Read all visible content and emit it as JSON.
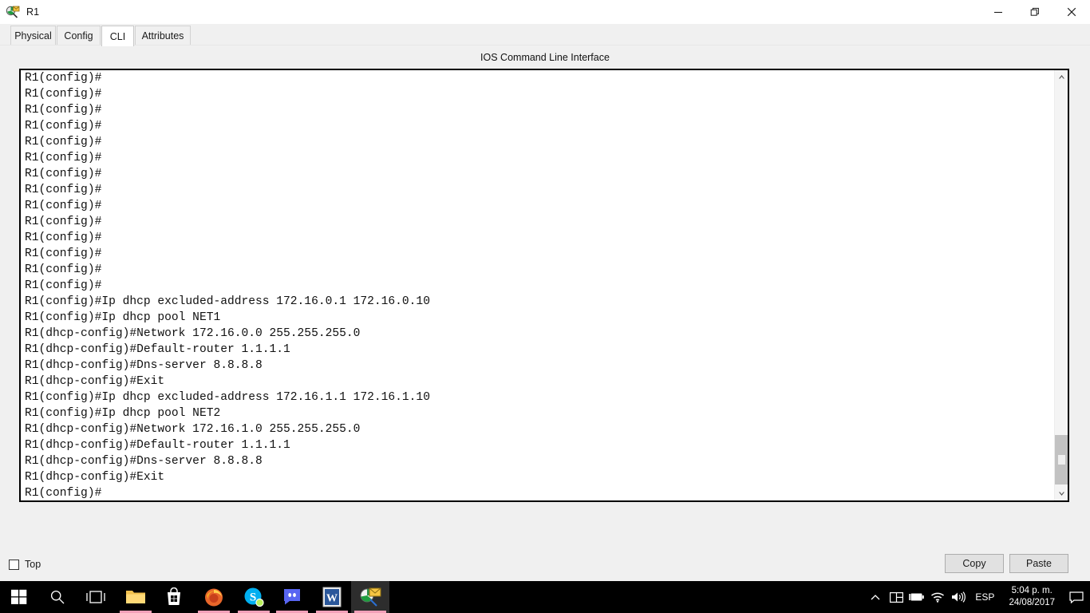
{
  "window": {
    "title": "R1",
    "icon": "packet-tracer-icon",
    "controls": {
      "minimize": "minimize-icon",
      "maximize": "restore-icon",
      "close": "close-icon"
    }
  },
  "tabs": [
    {
      "label": "Physical",
      "active": false
    },
    {
      "label": "Config",
      "active": false
    },
    {
      "label": "CLI",
      "active": true
    },
    {
      "label": "Attributes",
      "active": false
    }
  ],
  "cli": {
    "heading": "IOS Command Line Interface",
    "lines": [
      "R1(config)#",
      "R1(config)#",
      "R1(config)#",
      "R1(config)#",
      "R1(config)#",
      "R1(config)#",
      "R1(config)#",
      "R1(config)#",
      "R1(config)#",
      "R1(config)#",
      "R1(config)#",
      "R1(config)#",
      "R1(config)#",
      "R1(config)#",
      "R1(config)#Ip dhcp excluded-address 172.16.0.1 172.16.0.10",
      "R1(config)#Ip dhcp pool NET1",
      "R1(dhcp-config)#Network 172.16.0.0 255.255.255.0",
      "R1(dhcp-config)#Default-router 1.1.1.1",
      "R1(dhcp-config)#Dns-server 8.8.8.8",
      "R1(dhcp-config)#Exit",
      "R1(config)#Ip dhcp excluded-address 172.16.1.1 172.16.1.10",
      "R1(config)#Ip dhcp pool NET2",
      "R1(dhcp-config)#Network 172.16.1.0 255.255.255.0",
      "R1(dhcp-config)#Default-router 1.1.1.1",
      "R1(dhcp-config)#Dns-server 8.8.8.8",
      "R1(dhcp-config)#Exit",
      "R1(config)#"
    ]
  },
  "buttons": {
    "copy": "Copy",
    "paste": "Paste"
  },
  "top_option": {
    "label": "Top",
    "checked": false
  },
  "taskbar": {
    "items": [
      {
        "name": "start-button",
        "icon": "windows-logo-icon",
        "running": false
      },
      {
        "name": "search-button",
        "icon": "search-icon",
        "running": false
      },
      {
        "name": "task-view-button",
        "icon": "task-view-icon",
        "running": false
      },
      {
        "name": "file-explorer",
        "icon": "folder-icon",
        "running": true
      },
      {
        "name": "microsoft-store",
        "icon": "store-bag-icon",
        "running": false
      },
      {
        "name": "firefox",
        "icon": "firefox-icon",
        "running": true
      },
      {
        "name": "skype",
        "icon": "skype-icon",
        "running": true
      },
      {
        "name": "discord",
        "icon": "discord-icon",
        "running": true
      },
      {
        "name": "word",
        "icon": "word-icon",
        "running": true
      },
      {
        "name": "packet-tracer",
        "icon": "packet-tracer-icon",
        "running": true
      }
    ],
    "tray": {
      "show_hidden": "chevron-up-icon",
      "icons": [
        "action-center-tiles-icon",
        "battery-icon",
        "wifi-icon",
        "volume-icon"
      ],
      "language": "ESP",
      "time": "5:04 p. m.",
      "date": "24/08/2017",
      "notifications": "notification-icon"
    }
  },
  "colors": {
    "taskbar_bg": "#000000",
    "window_bg": "#f0f0f0",
    "terminal_bg": "#ffffff",
    "terminal_text": "#101010",
    "running_underline": "#f2a0b8"
  }
}
